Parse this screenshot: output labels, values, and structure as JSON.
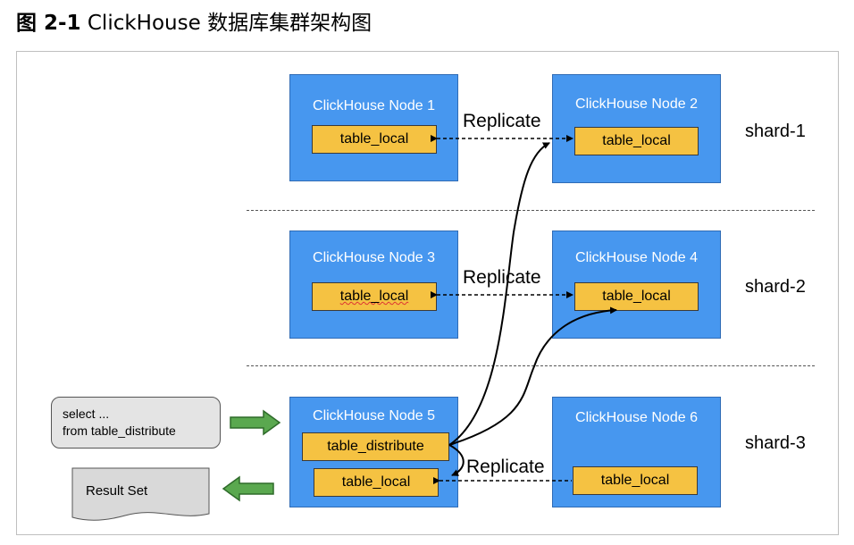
{
  "figure": {
    "label": "图 2-1",
    "title": "ClickHouse 数据库集群架构图"
  },
  "nodes": [
    {
      "title": "ClickHouse Node 1",
      "tables": [
        "table_local"
      ]
    },
    {
      "title": "ClickHouse Node 2",
      "tables": [
        "table_local"
      ]
    },
    {
      "title": "ClickHouse Node 3",
      "tables": [
        "table_local"
      ]
    },
    {
      "title": "ClickHouse Node 4",
      "tables": [
        "table_local"
      ]
    },
    {
      "title": "ClickHouse Node 5",
      "tables": [
        "table_distribute",
        "table_local"
      ]
    },
    {
      "title": "ClickHouse Node 6",
      "tables": [
        "table_local"
      ]
    }
  ],
  "replicate_labels": [
    "Replicate",
    "Replicate",
    "Replicate"
  ],
  "shards": [
    "shard-1",
    "shard-2",
    "shard-3"
  ],
  "query": {
    "line1": "select  ...",
    "line2": "from table_distribute"
  },
  "result": {
    "label": "Result Set"
  },
  "colors": {
    "node_fill": "#4797ef",
    "table_fill": "#f5c242",
    "arrow_green": "#5aa84f"
  }
}
